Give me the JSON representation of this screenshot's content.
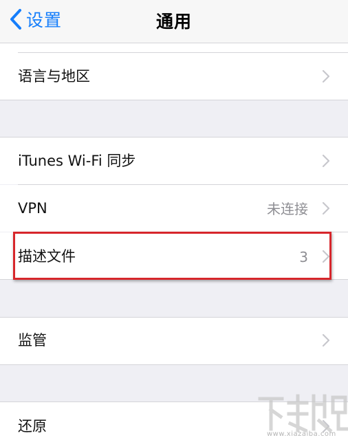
{
  "nav": {
    "back_label": "设置",
    "title": "通用"
  },
  "sections": [
    {
      "label": "语言与地区",
      "value": ""
    },
    {
      "label": "iTunes Wi-Fi 同步",
      "value": ""
    },
    {
      "label": "VPN",
      "value": "未连接"
    },
    {
      "label": "描述文件",
      "value": "3"
    },
    {
      "label": "监管",
      "value": ""
    },
    {
      "label": "还原",
      "value": ""
    }
  ],
  "watermark": {
    "url": "www.xiazaiba.com"
  },
  "colors": {
    "accent": "#157efb",
    "highlight": "#d7262b",
    "group_background": "#efeff4",
    "secondary_text": "#8e8e93"
  },
  "icons": {
    "back": "chevron-left-icon",
    "disclosure": "chevron-right-icon"
  }
}
